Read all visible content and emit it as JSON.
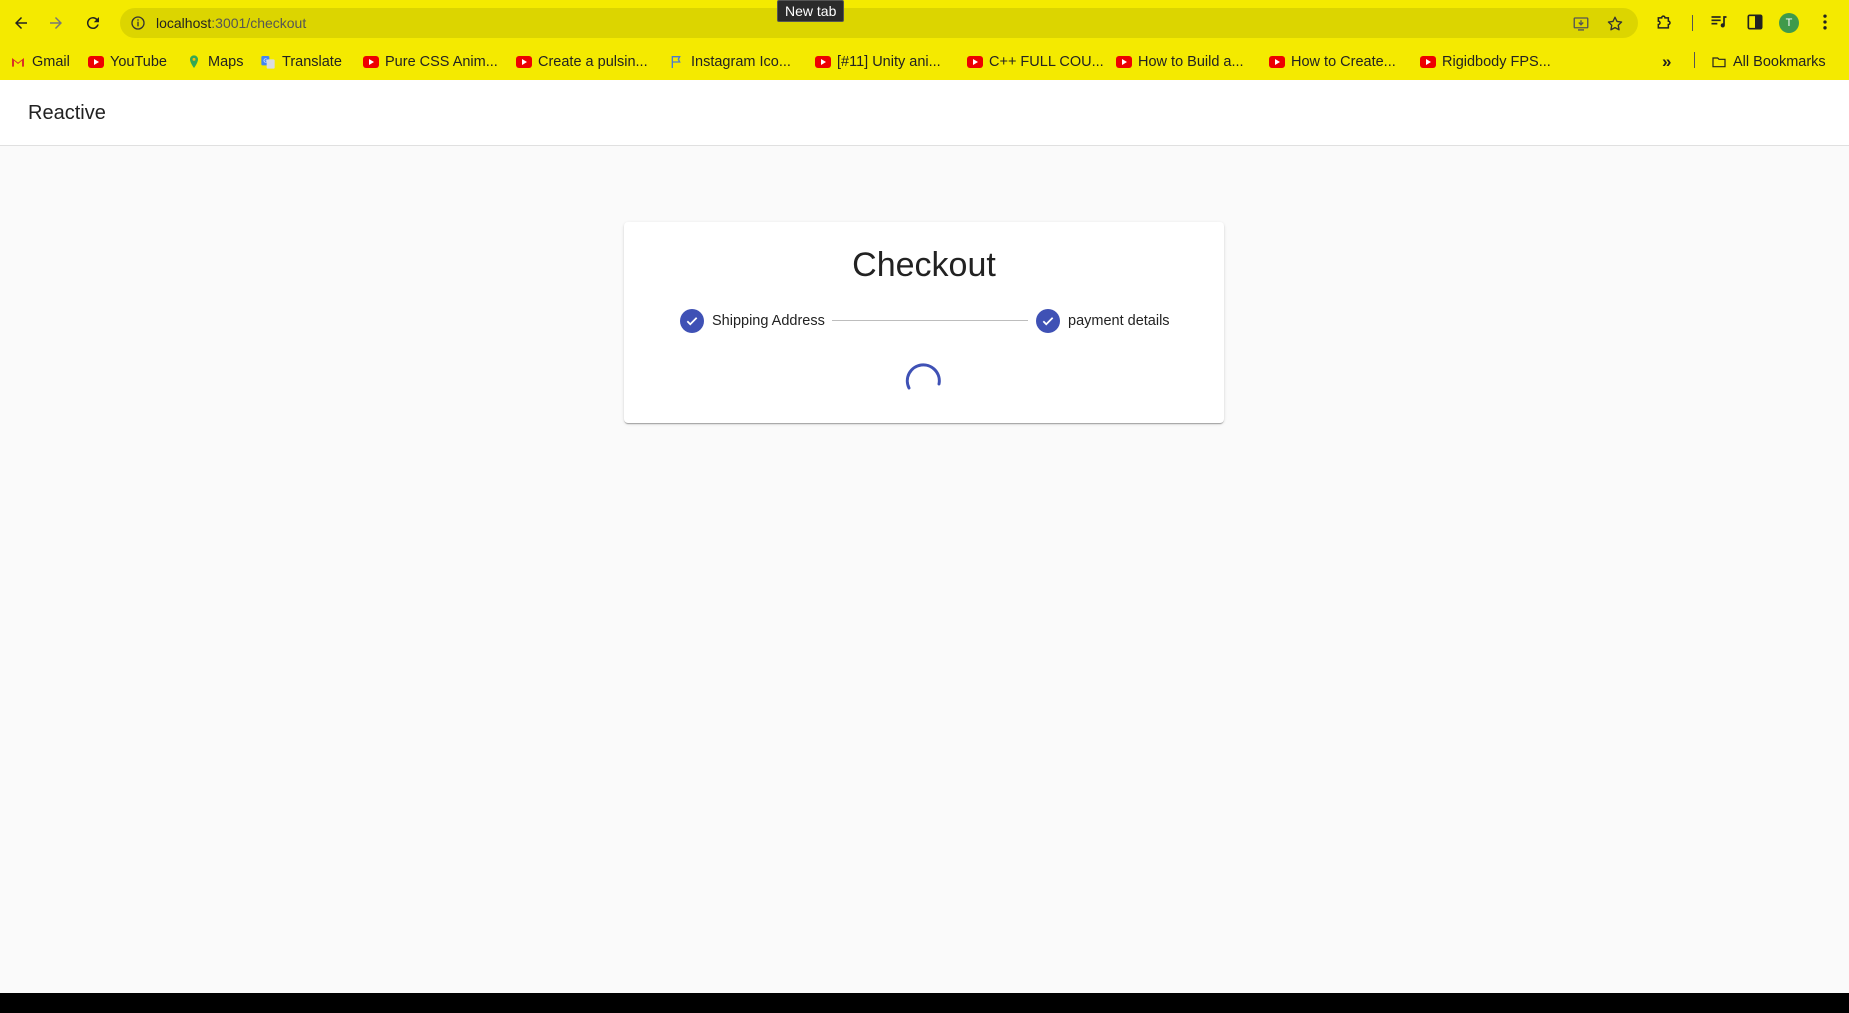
{
  "browser": {
    "url_host": "localhost",
    "url_path": ":3001/checkout",
    "tooltip": "New tab",
    "avatar_initial": "T",
    "bookmarks": [
      {
        "label": "Gmail",
        "icon": "gmail-icon"
      },
      {
        "label": "YouTube",
        "icon": "youtube-icon"
      },
      {
        "label": "Maps",
        "icon": "maps-icon"
      },
      {
        "label": "Translate",
        "icon": "translate-icon"
      },
      {
        "label": "Pure CSS Anim...",
        "icon": "youtube-icon"
      },
      {
        "label": "Create a pulsin...",
        "icon": "youtube-icon"
      },
      {
        "label": "Instagram Ico...",
        "icon": "flag-icon"
      },
      {
        "label": "[#11] Unity ani...",
        "icon": "youtube-icon"
      },
      {
        "label": "C++ FULL COU...",
        "icon": "youtube-icon"
      },
      {
        "label": "How to Build a...",
        "icon": "youtube-icon"
      },
      {
        "label": "How to Create...",
        "icon": "youtube-icon"
      },
      {
        "label": "Rigidbody FPS...",
        "icon": "youtube-icon"
      }
    ],
    "all_bookmarks": "All Bookmarks",
    "colors": {
      "chrome": "#f4ea00",
      "omnibox": "#dcd500"
    }
  },
  "app": {
    "title": "Reactive",
    "checkout": {
      "heading": "Checkout",
      "steps": [
        {
          "label": "Shipping Address",
          "status": "completed",
          "icon": "check-icon"
        },
        {
          "label": "payment details",
          "status": "completed",
          "icon": "check-icon"
        }
      ],
      "loading": true,
      "accent": "#3f51b5"
    }
  }
}
